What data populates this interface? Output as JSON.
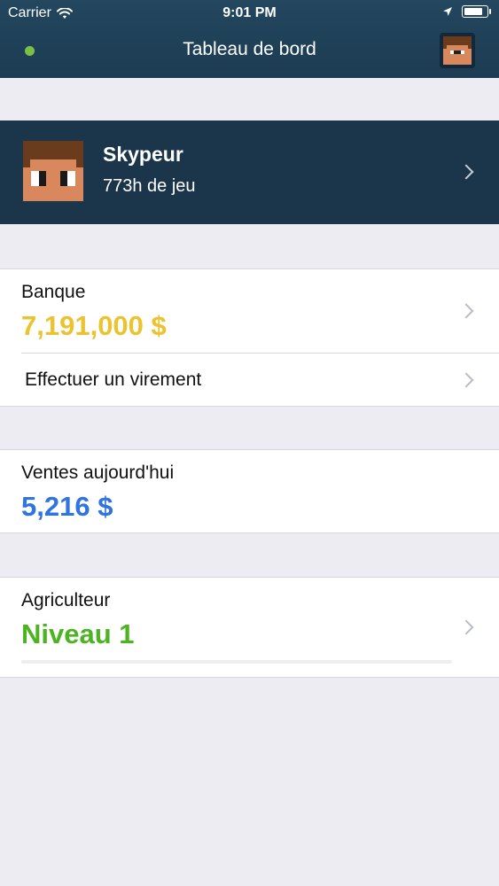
{
  "status_bar": {
    "carrier": "Carrier",
    "time": "9:01 PM",
    "battery_level": 0.85
  },
  "header": {
    "title": "Tableau de bord",
    "online_indicator_color": "#7bc043"
  },
  "profile": {
    "name": "Skypeur",
    "playtime": "773h de jeu"
  },
  "bank": {
    "label": "Banque",
    "amount": "7,191,000 $",
    "amount_color": "#ecc22e",
    "transfer_label": "Effectuer un virement"
  },
  "sales": {
    "label": "Ventes aujourd'hui",
    "amount": "5,216 $",
    "amount_color": "#2f74e0"
  },
  "job": {
    "label": "Agriculteur",
    "level": "Niveau 1",
    "level_color": "#4cb321",
    "progress": 0.0
  },
  "icons": {
    "wifi": "wifi-icon",
    "location": "location-arrow-icon",
    "battery": "battery-icon",
    "chevron": "chevron-right-icon"
  }
}
